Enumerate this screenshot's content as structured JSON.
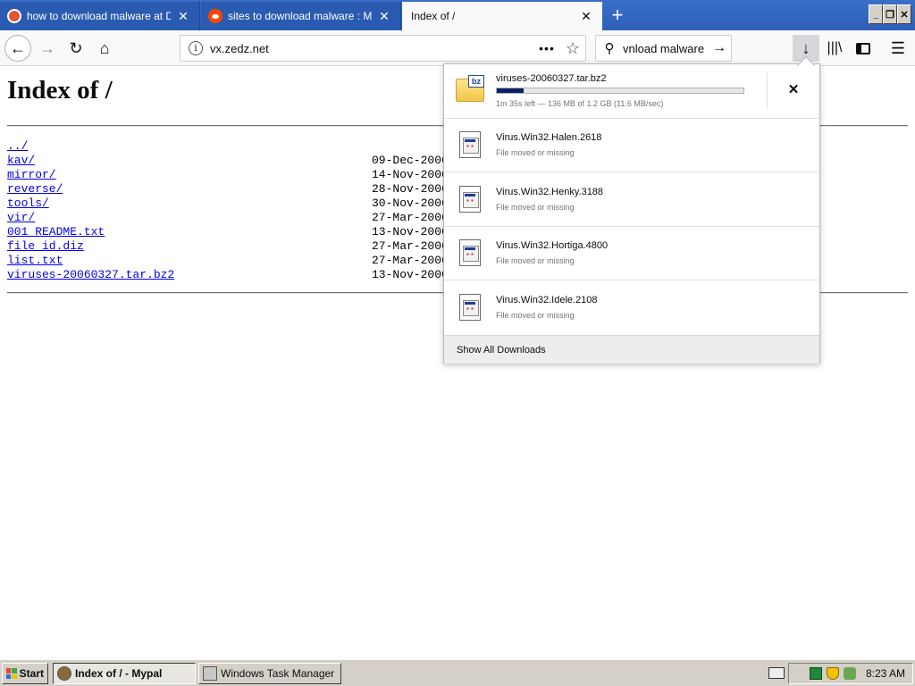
{
  "browser": {
    "tabs": [
      {
        "title": "how to download malware at DuckDuckGo",
        "favicon": "duckduckgo-icon",
        "active": false
      },
      {
        "title": "sites to download malware : Malware",
        "favicon": "reddit-icon",
        "active": false
      },
      {
        "title": "Index of /",
        "favicon": "",
        "active": true
      }
    ],
    "new_tab_symbol": "+",
    "window_buttons": {
      "minimize": "_",
      "restore": "❐",
      "close": "✕"
    },
    "url": "vx.zedz.net",
    "page_actions_symbol": "•••",
    "search_text": "vnload malware"
  },
  "page": {
    "title": "Index of /",
    "entries": [
      {
        "name": "../",
        "date": ""
      },
      {
        "name": "kav/",
        "date": "09-Dec-2006"
      },
      {
        "name": "mirror/",
        "date": "14-Nov-2006"
      },
      {
        "name": "reverse/",
        "date": "28-Nov-2006"
      },
      {
        "name": "tools/",
        "date": "30-Nov-2006"
      },
      {
        "name": "vir/",
        "date": "27-Mar-2006"
      },
      {
        "name": "001 README.txt",
        "date": "13-Nov-2006"
      },
      {
        "name": "file id.diz",
        "date": "27-Mar-2006"
      },
      {
        "name": "list.txt",
        "date": "27-Mar-2006"
      },
      {
        "name": "viruses-20060327.tar.bz2",
        "date": "13-Nov-2006"
      }
    ]
  },
  "downloads": {
    "active": {
      "name": "viruses-20060327.tar.bz2",
      "icon_tag": "bz",
      "status": "1m 35s left — 136 MB of 1.2 GB (11.6 MB/sec)",
      "progress_fraction": 0.11
    },
    "items": [
      {
        "name": "Virus.Win32.Halen.2618",
        "status": "File moved or missing"
      },
      {
        "name": "Virus.Win32.Henky.3188",
        "status": "File moved or missing"
      },
      {
        "name": "Virus.Win32.Hortiga.4800",
        "status": "File moved or missing"
      },
      {
        "name": "Virus.Win32.Idele.2108",
        "status": "File moved or missing"
      }
    ],
    "show_all": "Show All Downloads",
    "cancel_symbol": "✕"
  },
  "taskbar": {
    "start": "Start",
    "tasks": [
      {
        "label": "Index of / - Mypal",
        "pressed": true
      },
      {
        "label": "Windows Task Manager",
        "pressed": false
      }
    ],
    "clock": "8:23 AM"
  },
  "colors": {
    "tabstrip": "#3a6fc8",
    "progress_fill": "#0b1f66",
    "link": "#0000ee"
  }
}
